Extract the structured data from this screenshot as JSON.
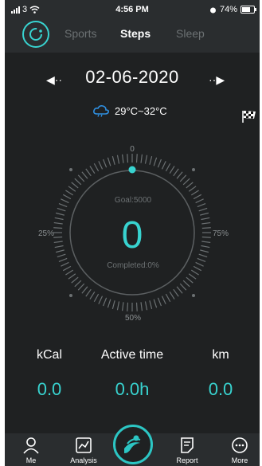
{
  "status_bar": {
    "carrier": "3",
    "time": "4:56 PM",
    "battery": "74%",
    "battery_level": 0.74
  },
  "header": {
    "tabs": [
      {
        "label": "Sports",
        "active": false
      },
      {
        "label": "Steps",
        "active": true
      },
      {
        "label": "Sleep",
        "active": false
      }
    ]
  },
  "date_nav": {
    "date": "02-06-2020"
  },
  "weather": {
    "temperature": "29°C~32°C"
  },
  "dial": {
    "top_label": "0",
    "left_label": "25%",
    "right_label": "75%",
    "bottom_label": "50%",
    "goal": "Goal:5000",
    "steps": "0",
    "completed": "Completed:0%",
    "progress": 0
  },
  "stats": {
    "labels": [
      "kCal",
      "Active time",
      "km"
    ],
    "values": [
      "0.0",
      "0.0h",
      "0.0"
    ]
  },
  "bottom_nav": {
    "items": [
      "Me",
      "Analysis",
      "Report",
      "More"
    ]
  },
  "colors": {
    "accent": "#38d3d0",
    "background": "#1f2122",
    "header": "#2a2d2f",
    "muted": "#6c7173"
  }
}
